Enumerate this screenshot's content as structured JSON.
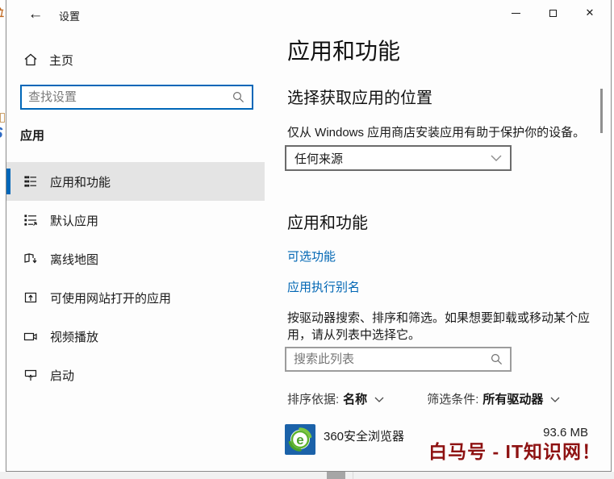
{
  "window": {
    "title": "设置",
    "controls": {
      "minimize_glyph": "—",
      "maximize_glyph": "",
      "close_glyph": "✕"
    },
    "back_glyph": "←"
  },
  "sidebar": {
    "home_label": "主页",
    "search_placeholder": "查找设置",
    "section_label": "应用",
    "items": [
      {
        "label": "应用和功能",
        "icon": "apps-features-icon",
        "selected": true
      },
      {
        "label": "默认应用",
        "icon": "default-apps-icon",
        "selected": false
      },
      {
        "label": "离线地图",
        "icon": "offline-maps-icon",
        "selected": false
      },
      {
        "label": "可使用网站打开的应用",
        "icon": "website-apps-icon",
        "selected": false
      },
      {
        "label": "视频播放",
        "icon": "video-playback-icon",
        "selected": false
      },
      {
        "label": "启动",
        "icon": "startup-icon",
        "selected": false
      }
    ]
  },
  "main": {
    "page_title": "应用和功能",
    "choose_heading": "选择获取应用的位置",
    "choose_desc": "仅从 Windows 应用商店安装应用有助于保护你的设备。",
    "source_dropdown_value": "任何来源",
    "section_heading": "应用和功能",
    "link_optional_features": "可选功能",
    "link_app_aliases": "应用执行别名",
    "list_desc": "按驱动器搜索、排序和筛选。如果想要卸载或移动某个应用，请从列表中选择它。",
    "list_search_placeholder": "搜索此列表",
    "sort_label": "排序依据:",
    "sort_value": "名称",
    "filter_label": "筛选条件:",
    "filter_value": "所有驱动器",
    "apps": [
      {
        "name": "360安全浏览器",
        "size": "93.6 MB",
        "icon": "360-browser-icon",
        "icon_letter": "e"
      }
    ]
  },
  "watermark_text": "白马号 - IT知识网！",
  "colors": {
    "accent": "#0067b8",
    "link": "#0066b4",
    "selected_row_bg": "#e4e4e4",
    "watermark": "#8e1212",
    "app_icon_blue": "#1b62a9",
    "app_icon_green": "#5db32d"
  }
}
